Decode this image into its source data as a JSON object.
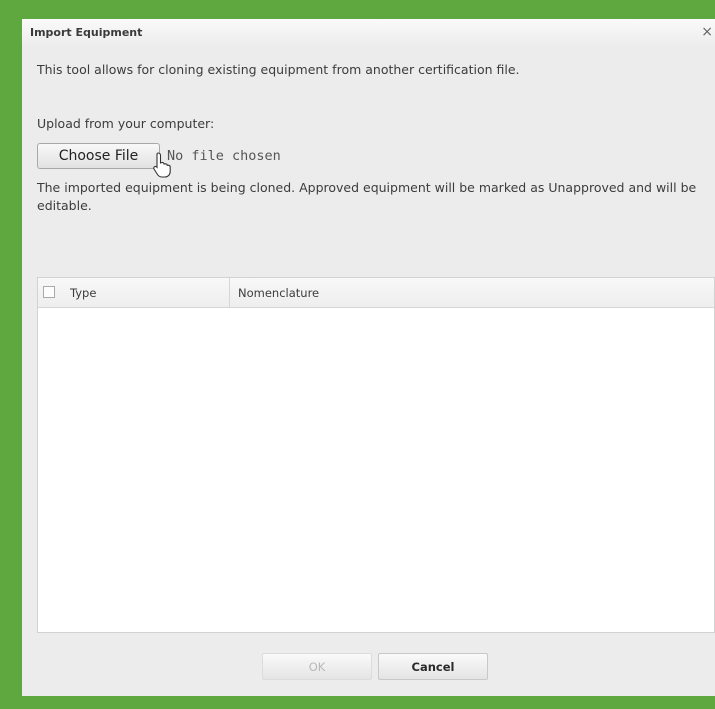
{
  "dialog": {
    "title": "Import Equipment",
    "close_glyph": "×",
    "description": "This tool allows for cloning existing equipment from another certification file.",
    "upload_label": "Upload from your computer:",
    "choose_file_label": "Choose File",
    "file_status": "No file chosen",
    "note": "The imported equipment is being cloned. Approved equipment will be marked as Unapproved and will be editable.",
    "table": {
      "columns": [
        "Type",
        "Nomenclature"
      ],
      "rows": []
    },
    "buttons": {
      "ok_label": "OK",
      "ok_enabled": false,
      "cancel_label": "Cancel"
    }
  },
  "colors": {
    "frame_border": "#5fa83f",
    "dialog_background": "#ececec"
  },
  "icons": [
    "close-icon",
    "mouse-cursor-icon"
  ]
}
